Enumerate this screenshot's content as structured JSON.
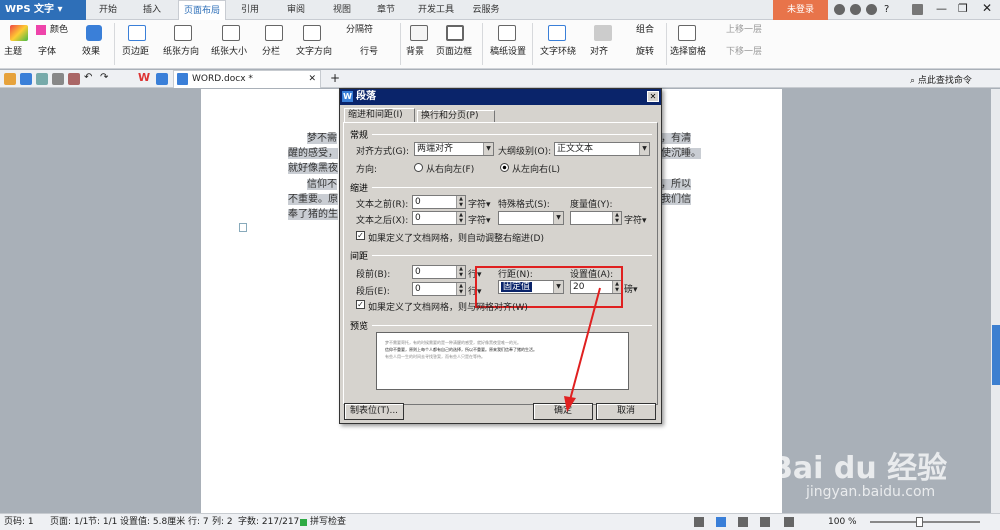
{
  "app": {
    "name": "WPS 文字"
  },
  "tabs": [
    "开始",
    "插入",
    "页面布局",
    "引用",
    "审阅",
    "视图",
    "章节",
    "开发工具",
    "云服务"
  ],
  "login": "未登录",
  "ribbon": {
    "theme": "主题",
    "colors": "颜色",
    "fonts": "字体",
    "effects": "效果",
    "margins": "页边距",
    "orientation": "纸张方向",
    "size": "纸张大小",
    "columns": "分栏",
    "textdir": "文字方向",
    "breaks": "分隔符",
    "lineno": "行号",
    "background": "背景",
    "borders": "页面边框",
    "draft": "稿纸设置",
    "wrap": "文字环绕",
    "align": "对齐",
    "rotate": "旋转",
    "group": "组合",
    "selpane": "选择窗格",
    "bringfwd": "上移一层",
    "sendback": "下移一层"
  },
  "doc": {
    "tab": "WORD.docx *",
    "search": "点此查找命令",
    "text": {
      "l1a": "梦不需",
      "l1b": "，有清",
      "l2a": "醒的感受，",
      "l2b": "使沉睡。",
      "l3a": "就好像黑夜",
      "l4a": "信仰不",
      "l4b": "，所以",
      "l5a": "不重要。原",
      "l5b": "我们信",
      "l6a": "奉了猪的生"
    }
  },
  "dialog": {
    "title": "段落",
    "tab1": "缩进和间距(I)",
    "tab2": "换行和分页(P)",
    "general": "常规",
    "align_label": "对齐方式(G):",
    "align_val": "两端对齐",
    "outline_label": "大纲级别(O):",
    "outline_val": "正文文本",
    "dir_label": "方向:",
    "rtl": "从右向左(F)",
    "ltr": "从左向右(L)",
    "indent": "缩进",
    "before_text": "文本之前(R):",
    "before_val": "0",
    "after_text": "文本之后(X):",
    "after_val": "0",
    "unit_char": "字符▾",
    "special": "特殊格式(S):",
    "measure": "度量值(Y):",
    "unit_char2": "字符▾",
    "auto_indent": "如果定义了文档网格，则自动调整右缩进(D)",
    "spacing": "间距",
    "sp_before": "段前(B):",
    "sp_before_val": "0",
    "sp_after": "段后(E):",
    "sp_after_val": "0",
    "unit_line": "行▾",
    "linesp": "行距(N):",
    "linesp_val": "固定值",
    "setval": "设置值(A):",
    "setval_val": "20",
    "unit_pt": "磅▾",
    "snap": "如果定义了文档网格，则与网格对齐(W)",
    "preview": "预览",
    "preview_text": [
      "梦不需要寄托，有的时候需要的是一种清醒的感受，就好像黑夜里唯一的光。",
      "信仰不重要，原则上每个人都有自己的选择，所以不重要。原来我们信奉了猪的生活。",
      "有些人用一生的时间去寻找答案，而有些人只是在等待。"
    ],
    "tabs_btn": "制表位(T)...",
    "ok": "确定",
    "cancel": "取消"
  },
  "status": {
    "page": "页码: 1",
    "pages": "页面: 1/1",
    "section": "节: 1/1",
    "setval": "设置值: 5.8厘米",
    "line": "行: 7",
    "col": "列: 2",
    "words": "字数: 217/217",
    "spell": "拼写检查",
    "zoom": "100 %"
  },
  "watermark": {
    "brand": "Bai du 经验",
    "url": "jingyan.baidu.com"
  },
  "colors": {
    "accent": "#2e6fb8",
    "dialog_title": "#0a246a",
    "highlight": "#e02020",
    "login": "#e8744a"
  }
}
